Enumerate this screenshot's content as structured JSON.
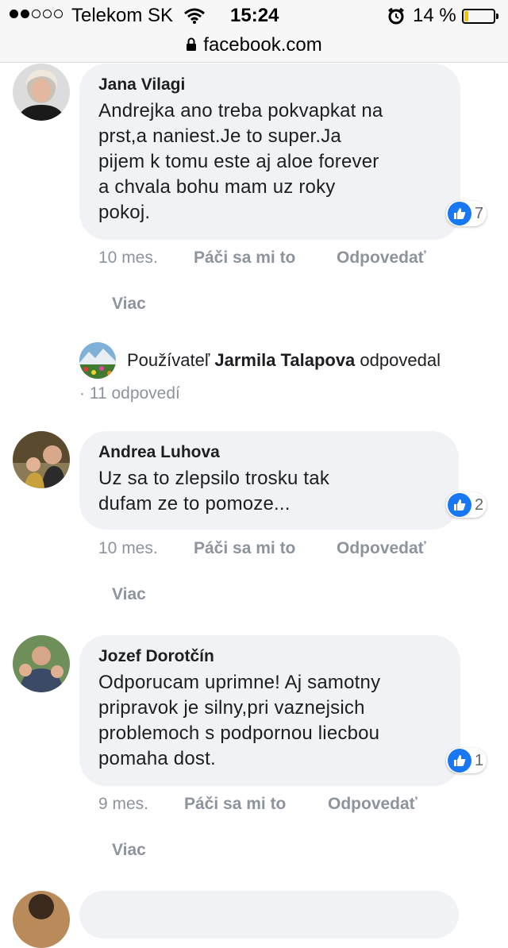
{
  "status_bar": {
    "carrier": "Telekom SK",
    "time": "15:24",
    "battery_percent": "14 %",
    "battery_level": 0.14,
    "signal_icon": "signal-dots-icon",
    "wifi_icon": "wifi-icon",
    "alarm_icon": "alarm-clock-icon"
  },
  "url_bar": {
    "url": "facebook.com",
    "icon": "lock-icon"
  },
  "colors": {
    "like_blue": "#1877f2",
    "bubble_bg": "#f0f2f5",
    "meta_gray": "#8d949e"
  },
  "comments": [
    {
      "author": "Jana Vilagi",
      "text_lines": [
        "Andrejka ano treba pokvapkat na",
        "prst,a naniest.Je to super.Ja",
        "pijem k tomu este aj aloe forever",
        "a chvala bohu mam uz roky",
        "pokoj."
      ],
      "likes": "7",
      "time": "10 mes.",
      "like_action": "Páči sa mi to",
      "reply_action": "Odpovedať",
      "more": "Viac"
    },
    {
      "author": "Andrea Luhova",
      "text_lines": [
        "Uz sa to zlepsilo trosku tak",
        "dufam ze to pomoze..."
      ],
      "likes": "2",
      "time": "10 mes.",
      "like_action": "Páči sa mi to",
      "reply_action": "Odpovedať",
      "more": "Viac"
    },
    {
      "author": "Jozef Dorotčín",
      "text_lines": [
        "Odporucam uprimne! Aj samotny",
        "pripravok je silny,pri vaznejsich",
        "problemoch s podpornou liecbou",
        "pomaha dost."
      ],
      "likes": "1",
      "time": "9 mes.",
      "like_action": "Páči sa mi to",
      "reply_action": "Odpovedať",
      "more": "Viac"
    }
  ],
  "replies_summary": {
    "prefix": "Používateľ",
    "name": "Jarmila Talapova",
    "suffix": "odpovedal",
    "count": "· 11 odpovedí"
  }
}
